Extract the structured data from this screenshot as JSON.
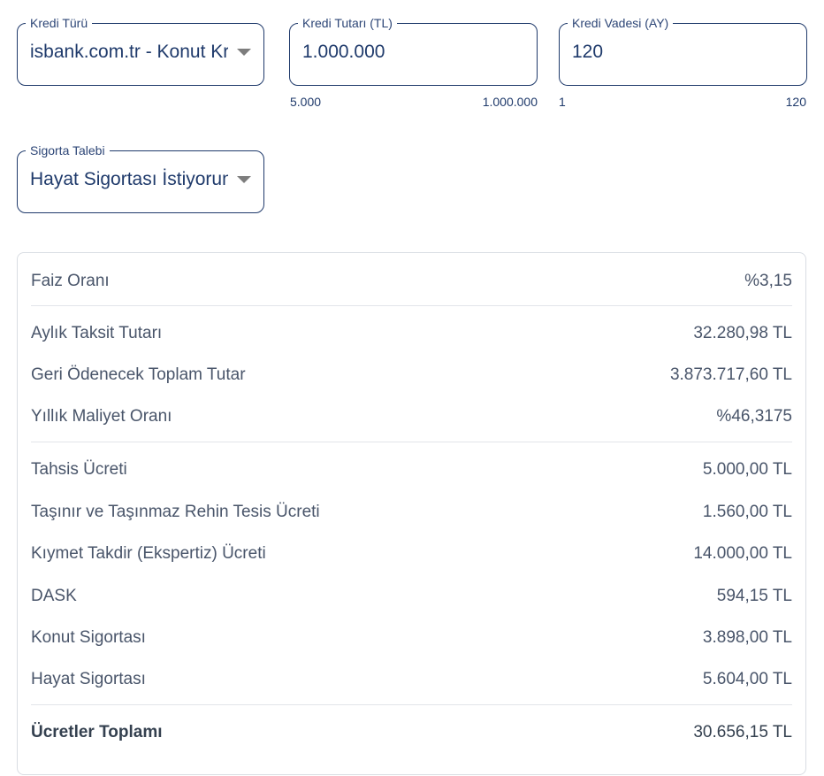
{
  "form": {
    "loan_type": {
      "label": "Kredi Türü",
      "value": "isbank.com.tr - Konut Kredisi",
      "caret_icon": "caret-down-icon"
    },
    "loan_amount": {
      "label": "Kredi Tutarı (TL)",
      "value": "1.000.000",
      "min": "5.000",
      "max": "1.000.000"
    },
    "loan_term": {
      "label": "Kredi Vadesi (AY)",
      "value": "120",
      "min": "1",
      "max": "120"
    },
    "insurance": {
      "label": "Sigorta Talebi",
      "value": "Hayat Sigortası İstiyorum",
      "caret_icon": "caret-down-icon"
    }
  },
  "results": {
    "interest_rate": {
      "label": "Faiz Oranı",
      "value": "%3,15"
    },
    "monthly_payment": {
      "label": "Aylık Taksit Tutarı",
      "value": "32.280,98 TL"
    },
    "total_repayment": {
      "label": "Geri Ödenecek Toplam Tutar",
      "value": "3.873.717,60 TL"
    },
    "annual_cost_rate": {
      "label": "Yıllık Maliyet Oranı",
      "value": "%46,3175"
    },
    "allocation_fee": {
      "label": "Tahsis Ücreti",
      "value": "5.000,00 TL"
    },
    "mortgage_fee": {
      "label": "Taşınır ve Taşınmaz Rehin Tesis Ücreti",
      "value": "1.560,00 TL"
    },
    "appraisal_fee": {
      "label": "Kıymet Takdir (Ekspertiz) Ücreti",
      "value": "14.000,00 TL"
    },
    "dask": {
      "label": "DASK",
      "value": "594,15 TL"
    },
    "home_insurance": {
      "label": "Konut Sigortası",
      "value": "3.898,00 TL"
    },
    "life_insurance": {
      "label": "Hayat Sigortası",
      "value": "5.604,00 TL"
    },
    "fees_total": {
      "label": "Ücretler Toplamı",
      "value": "30.656,15 TL"
    }
  },
  "colors": {
    "field_border": "#1f3a6b",
    "field_text": "#1f3a6b",
    "caret": "#7d7d7d",
    "card_border": "#d9dde3",
    "row_text": "#49556a"
  }
}
